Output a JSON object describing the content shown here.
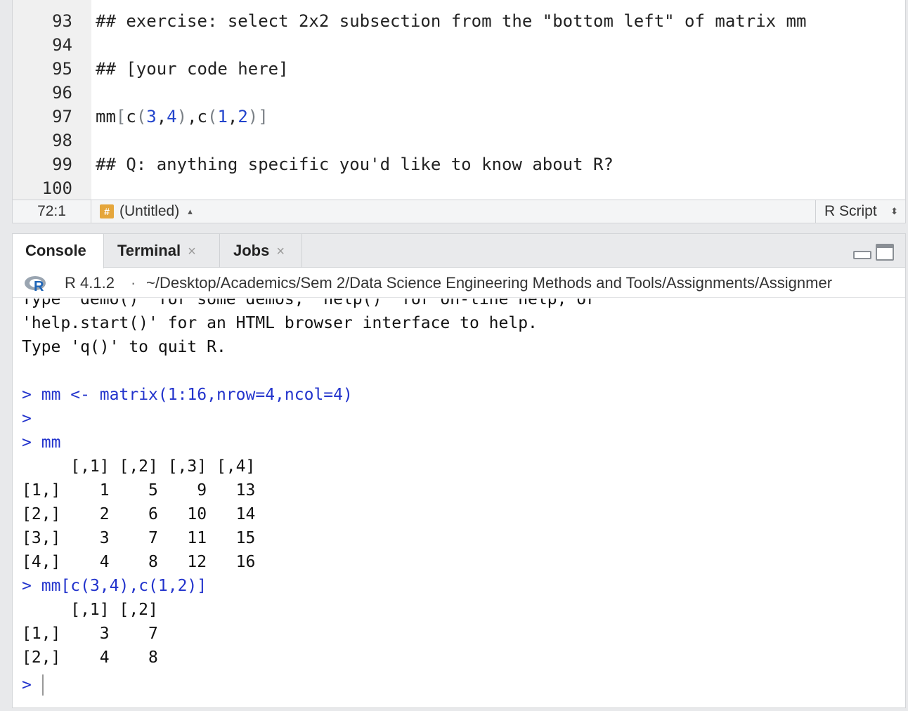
{
  "editor": {
    "lines": [
      {
        "number": "93",
        "text": "## exercise: select 2x2 subsection from the \"bottom left\" of matrix mm",
        "kind": "comment"
      },
      {
        "number": "94",
        "text": "",
        "kind": "blank"
      },
      {
        "number": "95",
        "text": "## [your code here]",
        "kind": "comment"
      },
      {
        "number": "96",
        "text": "",
        "kind": "blank"
      },
      {
        "number": "97",
        "text": "mm[c(3,4),c(1,2)]",
        "kind": "code"
      },
      {
        "number": "98",
        "text": "",
        "kind": "blank"
      },
      {
        "number": "99",
        "text": "## Q: anything specific you'd like to know about R?",
        "kind": "comment"
      },
      {
        "number": "100",
        "text": "",
        "kind": "blank"
      }
    ],
    "code_tokens": {
      "ident": "mm",
      "open_bracket": "[",
      "c1": "c",
      "open1": "(",
      "n1": "3",
      "comma1": ",",
      "n2": "4",
      "close1": ")",
      "comma2": ",",
      "c2": "c",
      "open2": "(",
      "n3": "1",
      "comma3": ",",
      "n4": "2",
      "close2": ")",
      "close_bracket": "]"
    },
    "status": {
      "cursor_position": "72:1",
      "section_badge": "#",
      "section_label": "(Untitled)",
      "file_type": "R Script"
    }
  },
  "console": {
    "tabs": [
      {
        "label": "Console",
        "closable": false
      },
      {
        "label": "Terminal",
        "closable": true
      },
      {
        "label": "Jobs",
        "closable": true
      }
    ],
    "close_glyph": "×",
    "r_version": "R 4.1.2",
    "separator": "·",
    "working_dir": "~/Desktop/Academics/Sem 2/Data Science Engineering Methods and Tools/Assignments/Assignmer",
    "output": [
      {
        "text": "Type 'demo()' for some demos, 'help()' for on-line help, or",
        "kind": "out"
      },
      {
        "text": "'help.start()' for an HTML browser interface to help.",
        "kind": "out"
      },
      {
        "text": "Type 'q()' to quit R.",
        "kind": "out"
      },
      {
        "text": "",
        "kind": "blank"
      },
      {
        "prompt": ">",
        "text": "mm <- matrix(1:16,nrow=4,ncol=4)",
        "kind": "cmd"
      },
      {
        "prompt": ">",
        "text": "",
        "kind": "cmd"
      },
      {
        "prompt": ">",
        "text": "mm",
        "kind": "cmd"
      },
      {
        "text": "     [,1] [,2] [,3] [,4]",
        "kind": "out"
      },
      {
        "text": "[1,]    1    5    9   13",
        "kind": "out"
      },
      {
        "text": "[2,]    2    6   10   14",
        "kind": "out"
      },
      {
        "text": "[3,]    3    7   11   15",
        "kind": "out"
      },
      {
        "text": "[4,]    4    8   12   16",
        "kind": "out"
      },
      {
        "prompt": ">",
        "text": "mm[c(3,4),c(1,2)]",
        "kind": "cmd"
      },
      {
        "text": "     [,1] [,2]",
        "kind": "out"
      },
      {
        "text": "[1,]    3    7",
        "kind": "out"
      },
      {
        "text": "[2,]    4    8",
        "kind": "out"
      },
      {
        "prompt": ">",
        "text": "",
        "kind": "cmd"
      }
    ]
  }
}
